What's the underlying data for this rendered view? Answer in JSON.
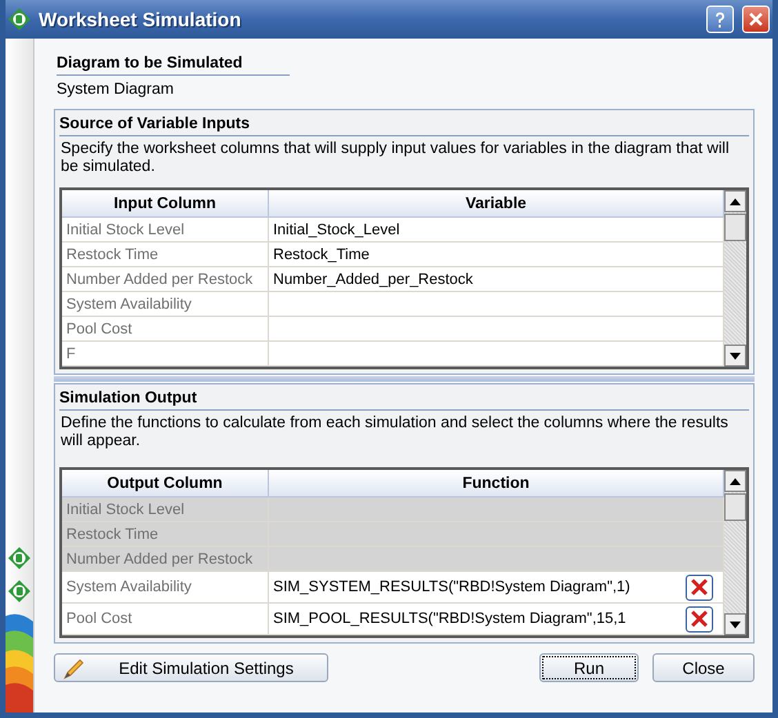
{
  "window": {
    "title": "Worksheet Simulation"
  },
  "diagram": {
    "heading": "Diagram to be Simulated",
    "value": "System Diagram"
  },
  "inputs": {
    "heading": "Source of Variable Inputs",
    "description": "Specify the worksheet columns that will supply input values for variables in the diagram that will be simulated.",
    "columns": [
      "Input Column",
      "Variable"
    ],
    "rows": [
      {
        "column": "Initial Stock Level",
        "variable": "Initial_Stock_Level"
      },
      {
        "column": "Restock Time",
        "variable": "Restock_Time"
      },
      {
        "column": "Number Added per Restock",
        "variable": "Number_Added_per_Restock"
      },
      {
        "column": "System Availability"
      },
      {
        "column": "Pool Cost"
      },
      {
        "column": "F"
      }
    ]
  },
  "outputs": {
    "heading": "Simulation Output",
    "description": "Define the functions to calculate from each simulation and select the columns where the results will appear.",
    "columns": [
      "Output Column",
      "Function"
    ],
    "rows": [
      {
        "column": "Initial Stock Level",
        "disabled": true
      },
      {
        "column": "Restock Time",
        "disabled": true
      },
      {
        "column": "Number Added per Restock",
        "disabled": true
      },
      {
        "column": "System Availability",
        "disabled": false,
        "function": "SIM_SYSTEM_RESULTS(\"RBD!System  Diagram\",1)"
      },
      {
        "column": "Pool Cost",
        "disabled": false,
        "function": "SIM_POOL_RESULTS(\"RBD!System Diagram\",15,1"
      }
    ]
  },
  "buttons": {
    "settings": "Edit Simulation Settings",
    "run": "Run",
    "close": "Close"
  }
}
